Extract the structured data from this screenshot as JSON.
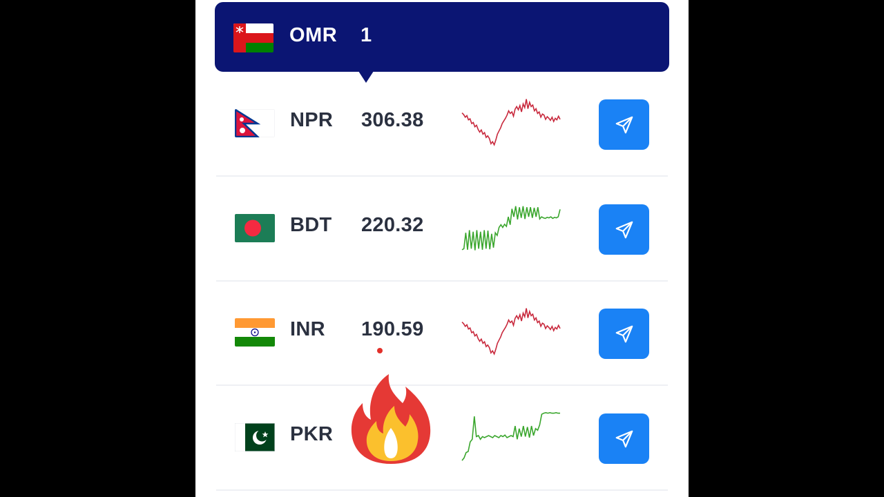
{
  "header": {
    "currency": "OMR",
    "amount": "1",
    "flag": "oman-flag"
  },
  "rows": [
    {
      "code": "NPR",
      "rate": "306.38",
      "flag": "nepal-flag",
      "trend_color": "#c8283c",
      "trend": [
        0.32,
        0.35,
        0.4,
        0.37,
        0.45,
        0.43,
        0.52,
        0.5,
        0.58,
        0.55,
        0.63,
        0.68,
        0.64,
        0.72,
        0.69,
        0.78,
        0.75,
        0.8,
        0.9,
        0.86,
        0.92,
        0.83,
        0.72,
        0.66,
        0.6,
        0.52,
        0.47,
        0.42,
        0.36,
        0.28,
        0.33,
        0.3,
        0.38,
        0.25,
        0.2,
        0.26,
        0.18,
        0.3,
        0.15,
        0.22,
        0.06,
        0.24,
        0.12,
        0.2,
        0.17,
        0.28,
        0.24,
        0.33,
        0.3,
        0.4,
        0.34,
        0.36,
        0.44,
        0.39,
        0.42,
        0.46,
        0.4,
        0.48,
        0.42,
        0.45,
        0.38,
        0.44
      ]
    },
    {
      "code": "BDT",
      "rate": "220.32",
      "flag": "bangladesh-flag",
      "trend_color": "#3aa62d",
      "trend": [
        0.92,
        0.9,
        0.6,
        0.92,
        0.55,
        0.9,
        0.58,
        0.93,
        0.55,
        0.9,
        0.58,
        0.92,
        0.55,
        0.9,
        0.56,
        0.91,
        0.62,
        0.88,
        0.6,
        0.65,
        0.5,
        0.45,
        0.5,
        0.44,
        0.48,
        0.3,
        0.45,
        0.15,
        0.3,
        0.1,
        0.35,
        0.12,
        0.32,
        0.1,
        0.34,
        0.12,
        0.3,
        0.12,
        0.32,
        0.13,
        0.3,
        0.12,
        0.34,
        0.3,
        0.32,
        0.33,
        0.31,
        0.32,
        0.3,
        0.33,
        0.31,
        0.32,
        0.3,
        0.16
      ]
    },
    {
      "code": "INR",
      "rate": "190.59",
      "flag": "india-flag",
      "trend_color": "#c8283c",
      "trend": [
        0.32,
        0.35,
        0.4,
        0.37,
        0.45,
        0.43,
        0.52,
        0.5,
        0.58,
        0.55,
        0.63,
        0.68,
        0.64,
        0.72,
        0.69,
        0.78,
        0.75,
        0.8,
        0.9,
        0.86,
        0.92,
        0.83,
        0.72,
        0.66,
        0.6,
        0.52,
        0.47,
        0.42,
        0.36,
        0.28,
        0.33,
        0.3,
        0.38,
        0.25,
        0.2,
        0.26,
        0.18,
        0.3,
        0.15,
        0.22,
        0.06,
        0.24,
        0.12,
        0.2,
        0.17,
        0.28,
        0.24,
        0.33,
        0.3,
        0.4,
        0.34,
        0.36,
        0.44,
        0.39,
        0.42,
        0.46,
        0.4,
        0.48,
        0.42,
        0.45,
        0.38,
        0.44
      ]
    },
    {
      "code": "PKR",
      "rate": "",
      "flag": "pakistan-flag",
      "trend_color": "#3aa62d",
      "trend": [
        0.95,
        0.9,
        0.8,
        0.78,
        0.6,
        0.55,
        0.12,
        0.5,
        0.48,
        0.55,
        0.5,
        0.52,
        0.5,
        0.48,
        0.5,
        0.52,
        0.48,
        0.5,
        0.52,
        0.48,
        0.5,
        0.47,
        0.52,
        0.5,
        0.48,
        0.5,
        0.3,
        0.55,
        0.35,
        0.5,
        0.3,
        0.5,
        0.32,
        0.52,
        0.3,
        0.48,
        0.35,
        0.38,
        0.28,
        0.08,
        0.06,
        0.05,
        0.06,
        0.05,
        0.06,
        0.06,
        0.05,
        0.06,
        0.06
      ]
    }
  ],
  "overlay": {
    "emoji": "fire-emoji"
  }
}
